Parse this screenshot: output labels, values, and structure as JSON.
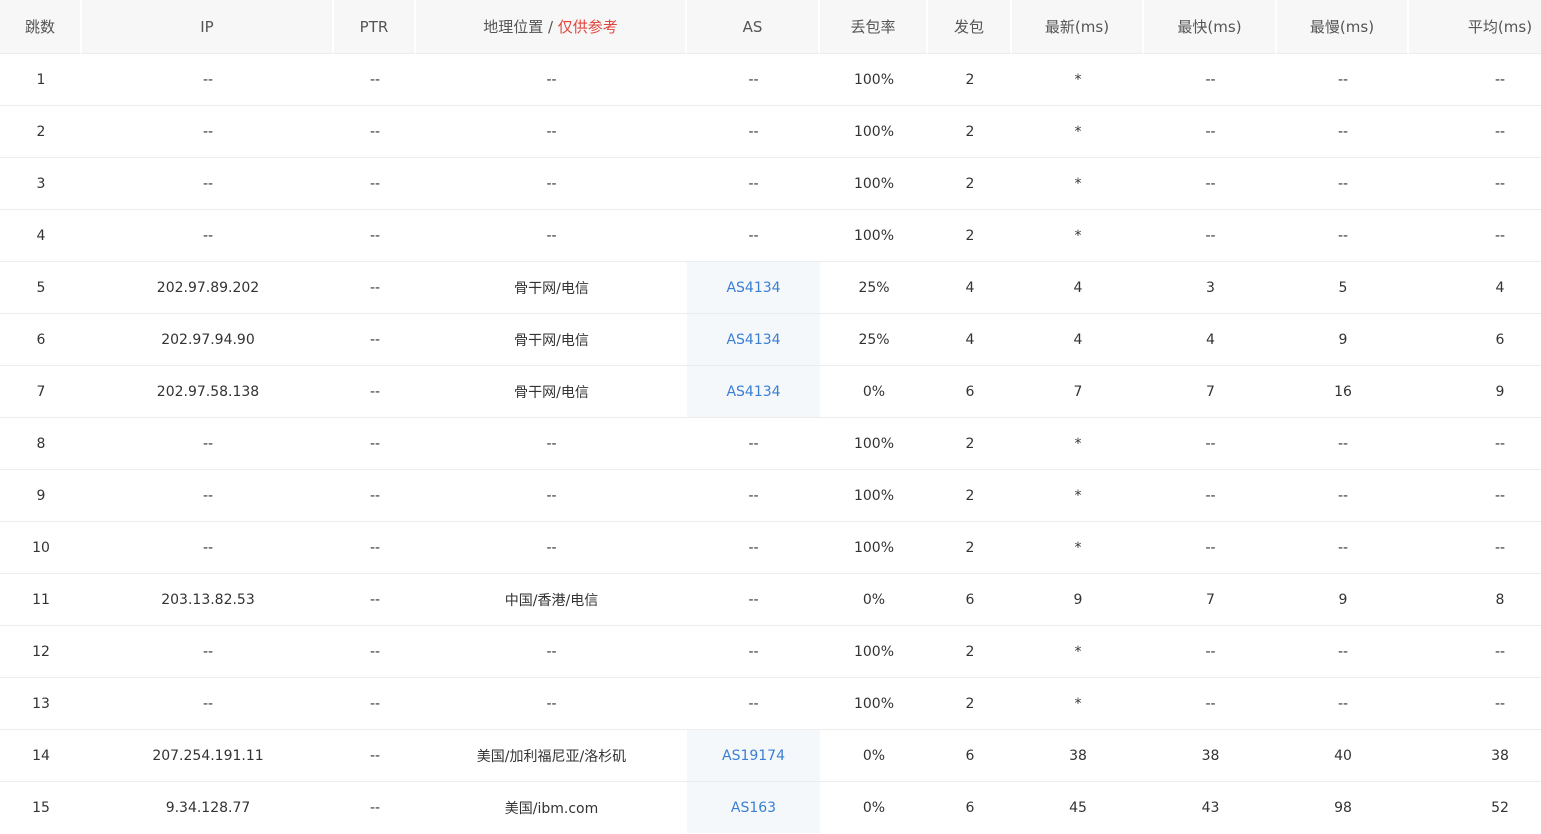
{
  "header": {
    "hop": "跳数",
    "ip": "IP",
    "ptr": "PTR",
    "geo": "地理位置",
    "geo_sep": " / ",
    "geo_note": "仅供参考",
    "as": "AS",
    "loss": "丢包率",
    "sent": "发包",
    "last": "最新(ms)",
    "best": "最快(ms)",
    "worst": "最慢(ms)",
    "avg": "平均(ms)"
  },
  "colors": {
    "note_red": "#e0463c",
    "link_blue": "#3a7fd3"
  },
  "rows": [
    {
      "hop": "1",
      "ip": "--",
      "ptr": "--",
      "geo": "--",
      "as": "--",
      "loss": "100%",
      "sent": "2",
      "last": "*",
      "best": "--",
      "worst": "--",
      "avg": "--"
    },
    {
      "hop": "2",
      "ip": "--",
      "ptr": "--",
      "geo": "--",
      "as": "--",
      "loss": "100%",
      "sent": "2",
      "last": "*",
      "best": "--",
      "worst": "--",
      "avg": "--"
    },
    {
      "hop": "3",
      "ip": "--",
      "ptr": "--",
      "geo": "--",
      "as": "--",
      "loss": "100%",
      "sent": "2",
      "last": "*",
      "best": "--",
      "worst": "--",
      "avg": "--"
    },
    {
      "hop": "4",
      "ip": "--",
      "ptr": "--",
      "geo": "--",
      "as": "--",
      "loss": "100%",
      "sent": "2",
      "last": "*",
      "best": "--",
      "worst": "--",
      "avg": "--"
    },
    {
      "hop": "5",
      "ip": "202.97.89.202",
      "ptr": "--",
      "geo": "骨干网/电信",
      "as": "AS4134",
      "loss": "25%",
      "sent": "4",
      "last": "4",
      "best": "3",
      "worst": "5",
      "avg": "4"
    },
    {
      "hop": "6",
      "ip": "202.97.94.90",
      "ptr": "--",
      "geo": "骨干网/电信",
      "as": "AS4134",
      "loss": "25%",
      "sent": "4",
      "last": "4",
      "best": "4",
      "worst": "9",
      "avg": "6"
    },
    {
      "hop": "7",
      "ip": "202.97.58.138",
      "ptr": "--",
      "geo": "骨干网/电信",
      "as": "AS4134",
      "loss": "0%",
      "sent": "6",
      "last": "7",
      "best": "7",
      "worst": "16",
      "avg": "9"
    },
    {
      "hop": "8",
      "ip": "--",
      "ptr": "--",
      "geo": "--",
      "as": "--",
      "loss": "100%",
      "sent": "2",
      "last": "*",
      "best": "--",
      "worst": "--",
      "avg": "--"
    },
    {
      "hop": "9",
      "ip": "--",
      "ptr": "--",
      "geo": "--",
      "as": "--",
      "loss": "100%",
      "sent": "2",
      "last": "*",
      "best": "--",
      "worst": "--",
      "avg": "--"
    },
    {
      "hop": "10",
      "ip": "--",
      "ptr": "--",
      "geo": "--",
      "as": "--",
      "loss": "100%",
      "sent": "2",
      "last": "*",
      "best": "--",
      "worst": "--",
      "avg": "--"
    },
    {
      "hop": "11",
      "ip": "203.13.82.53",
      "ptr": "--",
      "geo": "中国/香港/电信",
      "as": "--",
      "loss": "0%",
      "sent": "6",
      "last": "9",
      "best": "7",
      "worst": "9",
      "avg": "8"
    },
    {
      "hop": "12",
      "ip": "--",
      "ptr": "--",
      "geo": "--",
      "as": "--",
      "loss": "100%",
      "sent": "2",
      "last": "*",
      "best": "--",
      "worst": "--",
      "avg": "--"
    },
    {
      "hop": "13",
      "ip": "--",
      "ptr": "--",
      "geo": "--",
      "as": "--",
      "loss": "100%",
      "sent": "2",
      "last": "*",
      "best": "--",
      "worst": "--",
      "avg": "--"
    },
    {
      "hop": "14",
      "ip": "207.254.191.11",
      "ptr": "--",
      "geo": "美国/加利福尼亚/洛杉矶",
      "as": "AS19174",
      "loss": "0%",
      "sent": "6",
      "last": "38",
      "best": "38",
      "worst": "40",
      "avg": "38"
    },
    {
      "hop": "15",
      "ip": "9.34.128.77",
      "ptr": "--",
      "geo": "美国/ibm.com",
      "as": "AS163",
      "loss": "0%",
      "sent": "6",
      "last": "45",
      "best": "43",
      "worst": "98",
      "avg": "52"
    }
  ]
}
